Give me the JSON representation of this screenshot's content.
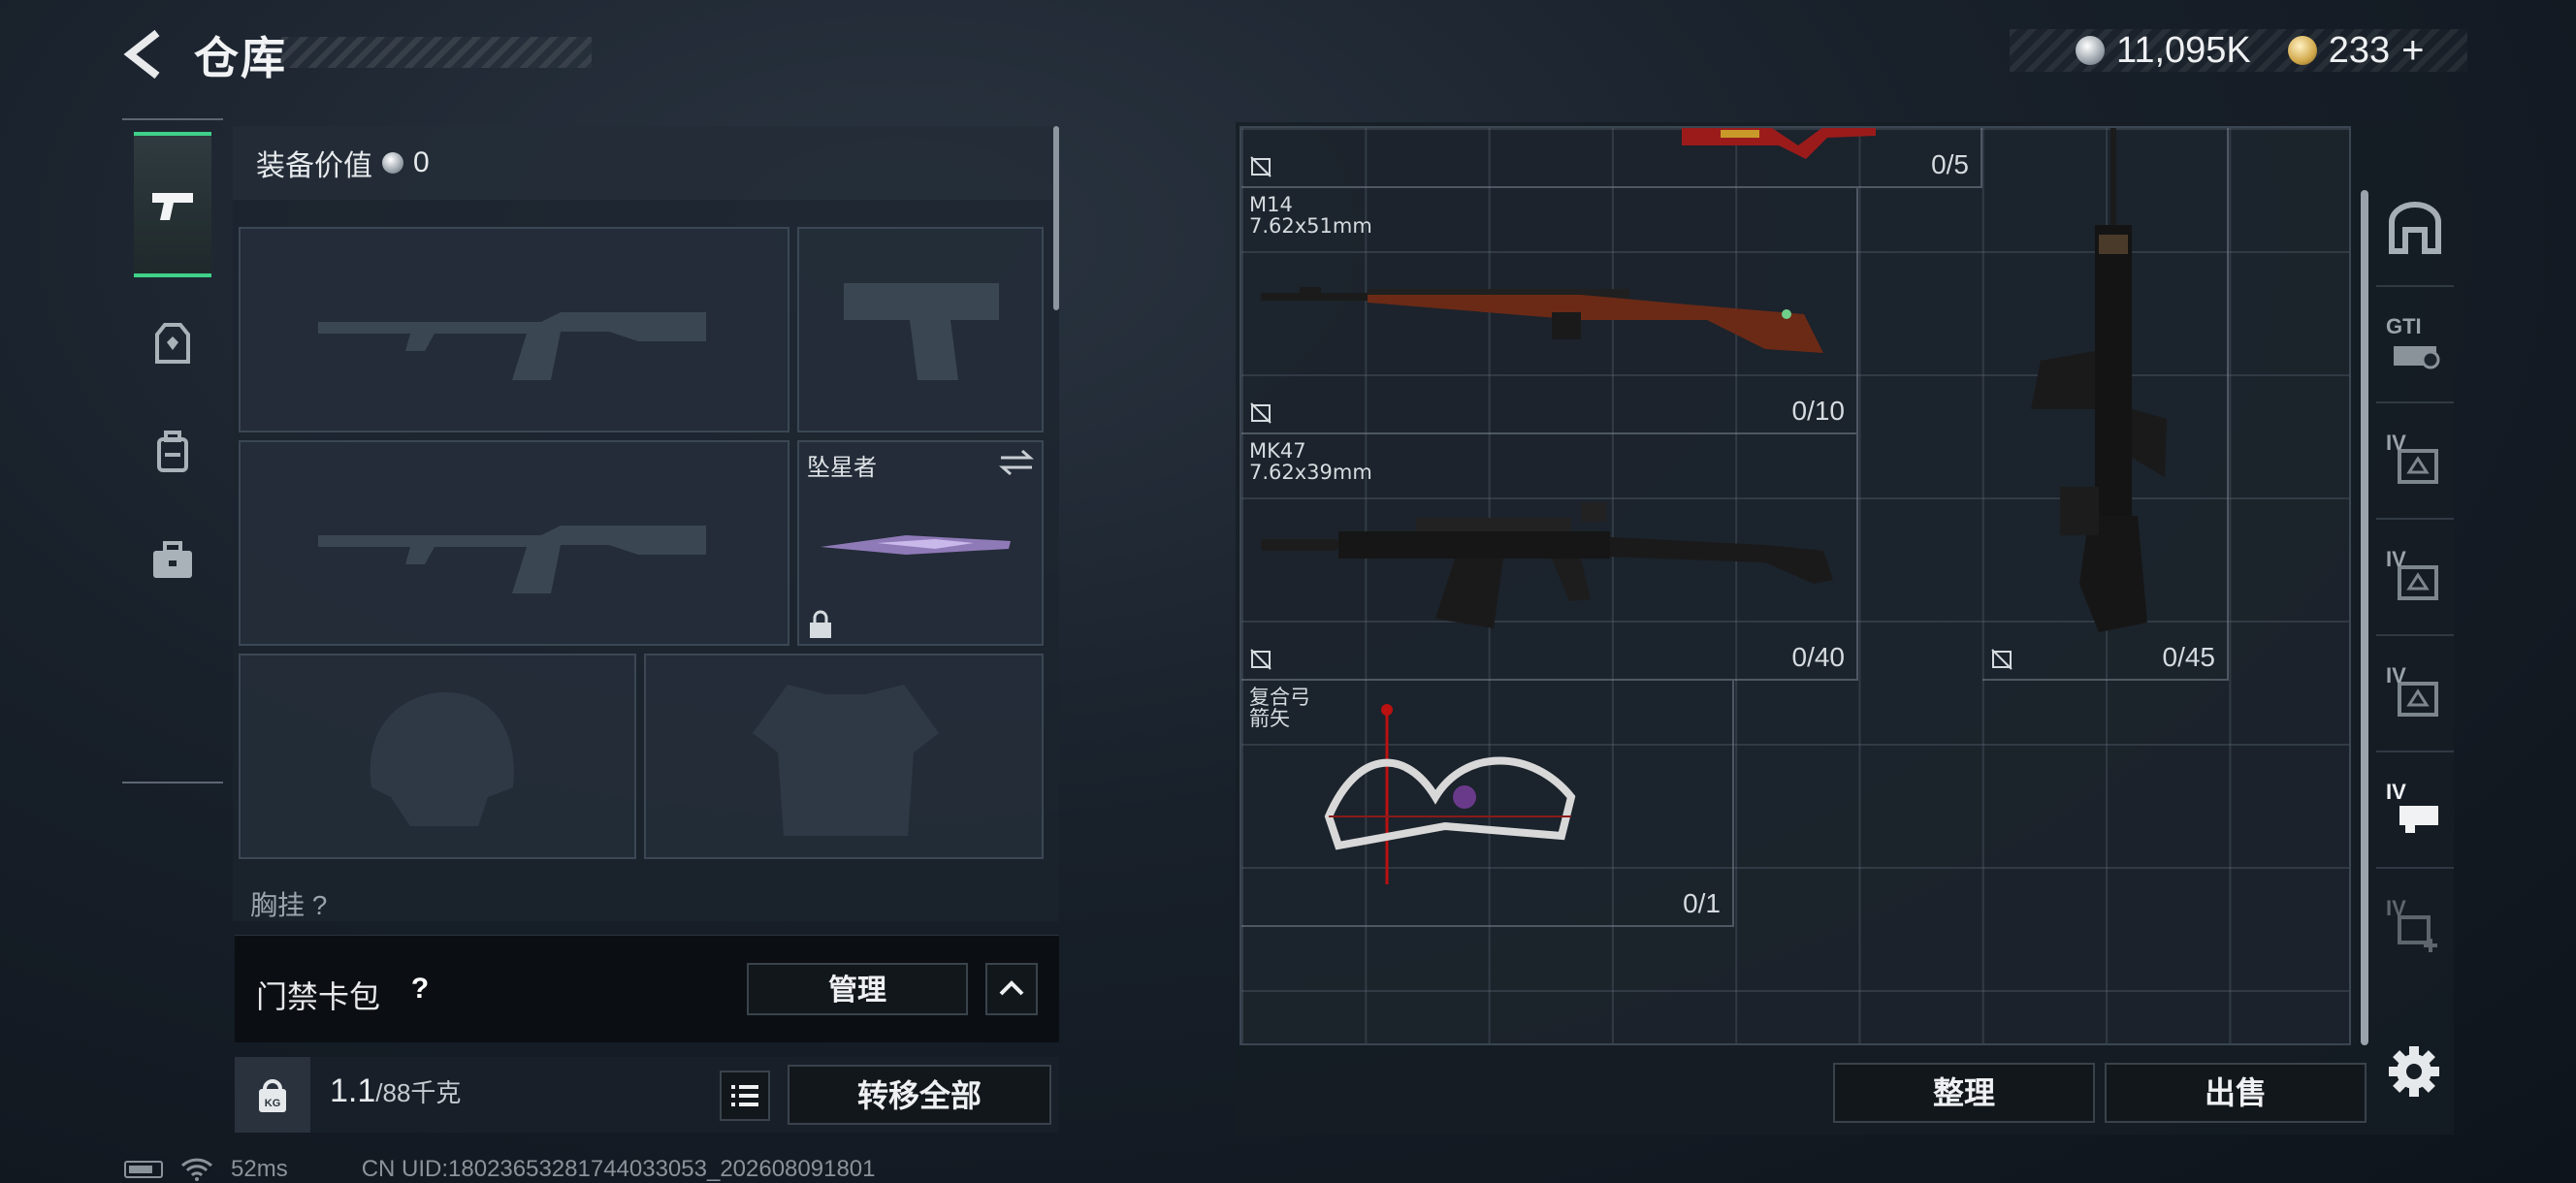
{
  "header": {
    "title": "仓库",
    "silver_amount": "11,095K",
    "gold_amount": "233",
    "gold_plus": "+"
  },
  "equipment": {
    "value_label": "装备价值",
    "value_amount": "0",
    "knife_name": "坠星者",
    "next_section_label": "胸挂 ?"
  },
  "card_bag": {
    "label": "门禁卡包",
    "help": "?",
    "manage_label": "管理"
  },
  "weight": {
    "current": "1.1",
    "max": "/88千克",
    "kg_badge": "KG",
    "transfer_all_label": "转移全部"
  },
  "status": {
    "ping": "52ms",
    "uid": "CN UID:18023653281744033053_202608091801"
  },
  "warehouse": {
    "items": [
      {
        "name": "",
        "caliber": "",
        "count": "0/5"
      },
      {
        "name": "M14",
        "caliber": "7.62x51mm",
        "count": "0/10"
      },
      {
        "name": "MK47",
        "caliber": "7.62x39mm",
        "count": "0/40"
      },
      {
        "name": "",
        "caliber": "",
        "count": "0/45"
      },
      {
        "name": "复合弓",
        "caliber": "箭矢",
        "count": "0/1"
      }
    ],
    "sort_label": "整理",
    "sell_label": "出售",
    "tabs": [
      {
        "icon": "home-storage-icon",
        "label": ""
      },
      {
        "icon": "gti-storage-icon",
        "label": "GTI"
      },
      {
        "icon": "storage-iv-icon",
        "label": "IV"
      },
      {
        "icon": "storage-iv-icon",
        "label": "IV"
      },
      {
        "icon": "storage-iv-icon",
        "label": "IV"
      },
      {
        "icon": "weapon-storage-icon",
        "label": "IV"
      },
      {
        "icon": "add-storage-icon",
        "label": "IV"
      }
    ]
  },
  "colors": {
    "accent_green": "#3fd18a",
    "panel": "#1c242e",
    "button_bg": "#12171c"
  }
}
